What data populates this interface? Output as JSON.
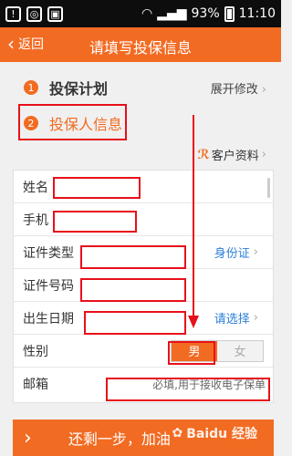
{
  "statusbar": {
    "left_icons": [
      "notification-icon",
      "sync-icon",
      "image-icon"
    ],
    "battery": "93%",
    "time": "11:10"
  },
  "header": {
    "back_label": "返回",
    "title": "请填写投保信息"
  },
  "steps": [
    {
      "num": "1",
      "label": "投保计划",
      "action": "展开修改"
    },
    {
      "num": "2",
      "label": "投保人信息"
    }
  ],
  "customer_link": "客户资料",
  "form": {
    "name_label": "姓名",
    "phone_label": "手机",
    "id_type_label": "证件类型",
    "id_type_value": "身份证",
    "id_number_label": "证件号码",
    "birthday_label": "出生日期",
    "birthday_value": "请选择",
    "gender_label": "性别",
    "gender_male": "男",
    "gender_female": "女",
    "email_label": "邮箱",
    "email_placeholder": "必填,用于接收电子保单"
  },
  "footer": {
    "button_label": "还剩一步，加油",
    "watermark": "Baidu 经验"
  },
  "colors": {
    "accent": "#f26b22",
    "annotation_red": "#e8101a",
    "link_blue": "#2a7fd9"
  }
}
